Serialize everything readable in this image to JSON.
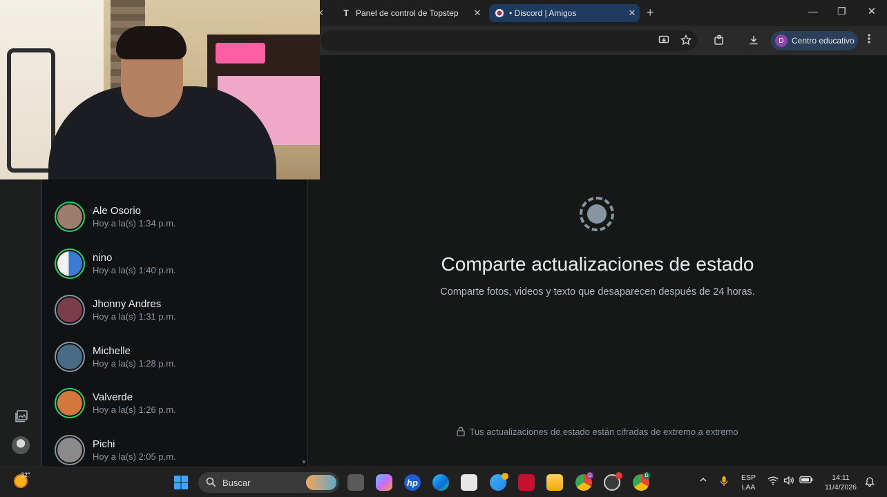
{
  "browser": {
    "tabs": [
      {
        "title": "Panel de control de Topstep",
        "favicon": "T",
        "active": false
      },
      {
        "title": "• Discord | Amigos",
        "active": true
      }
    ],
    "profile_label": "Centro educativo",
    "profile_initial": "D",
    "close_glyph": "✕",
    "newtab_glyph": "+",
    "minimize_glyph": "—",
    "restore_glyph": "❐",
    "window_close_glyph": "✕"
  },
  "status_list": [
    {
      "name": "Ale Osorio",
      "time": "Hoy a la(s) 1:34 p.m.",
      "ring": "unseen",
      "color": "#9c7c6a"
    },
    {
      "name": "nino",
      "time": "Hoy a la(s) 1:40 p.m.",
      "ring": "unseen",
      "color": "#3a7bd5"
    },
    {
      "name": "Jhonny Andres",
      "time": "Hoy a la(s) 1:31 p.m.",
      "ring": "seen",
      "color": "#7a3d4a"
    },
    {
      "name": "Michelle",
      "time": "Hoy a la(s) 1:28 p.m.",
      "ring": "seen",
      "color": "#4a6b85"
    },
    {
      "name": "Valverde",
      "time": "Hoy a la(s) 1:26 p.m.",
      "ring": "unseen",
      "color": "#d2783c"
    },
    {
      "name": "Pichi",
      "time": "Hoy a la(s) 2:05 p.m.",
      "ring": "seen",
      "color": "#8a8a8a"
    }
  ],
  "main": {
    "title": "Comparte actualizaciones de estado",
    "subtitle": "Comparte fotos, videos y texto que desaparecen después de 24 horas.",
    "encryption_note": "Tus actualizaciones de estado están cifradas de extremo a extremo"
  },
  "taskbar": {
    "temperature": "32°",
    "search_placeholder": "Buscar",
    "language_line1": "ESP",
    "language_line2": "LAA",
    "time": "14:11",
    "date": "11/4/2026",
    "hp_label": "hp",
    "chrome_badge_1": "D",
    "chrome_badge_2": "D"
  },
  "colors": {
    "accent_green": "#25d366",
    "active_tab": "#1e3a5f"
  }
}
